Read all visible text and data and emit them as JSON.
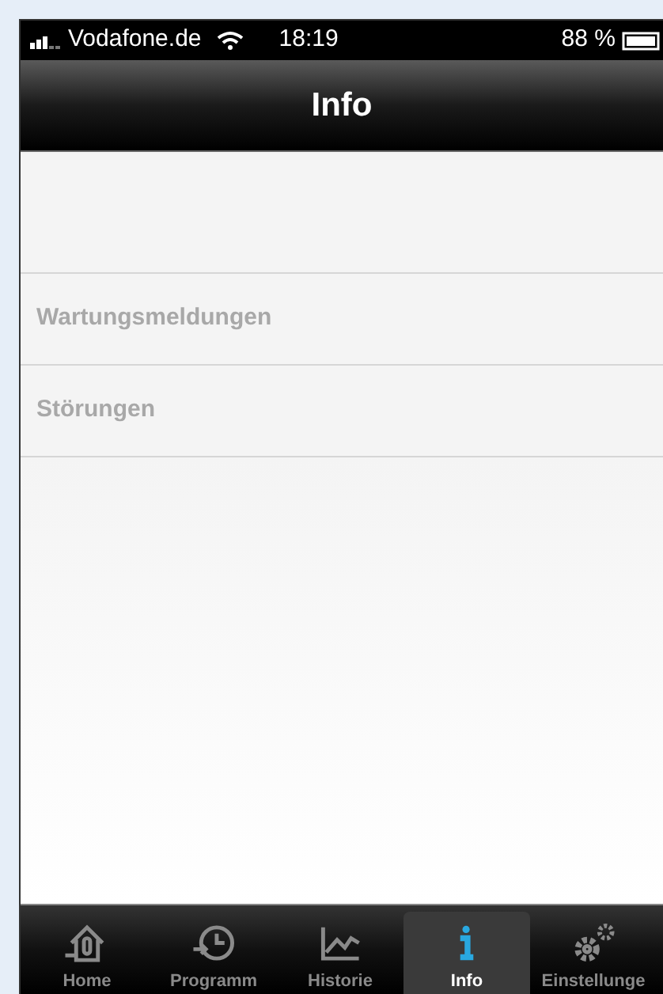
{
  "status_bar": {
    "carrier": "Vodafone.de",
    "time": "18:19",
    "battery": "88 %"
  },
  "nav_bar": {
    "title": "Info"
  },
  "list": {
    "items": [
      {
        "label": "Wartungsmeldungen"
      },
      {
        "label": "Störungen"
      }
    ]
  },
  "tab_bar": {
    "tabs": [
      {
        "kind": "home",
        "label": "Home",
        "selected": false
      },
      {
        "kind": "program",
        "label": "Programm",
        "selected": false
      },
      {
        "kind": "history",
        "label": "Historie",
        "selected": false
      },
      {
        "kind": "info",
        "label": "Info",
        "selected": true
      },
      {
        "kind": "settings",
        "label": "Einstellunge",
        "selected": false
      }
    ]
  }
}
